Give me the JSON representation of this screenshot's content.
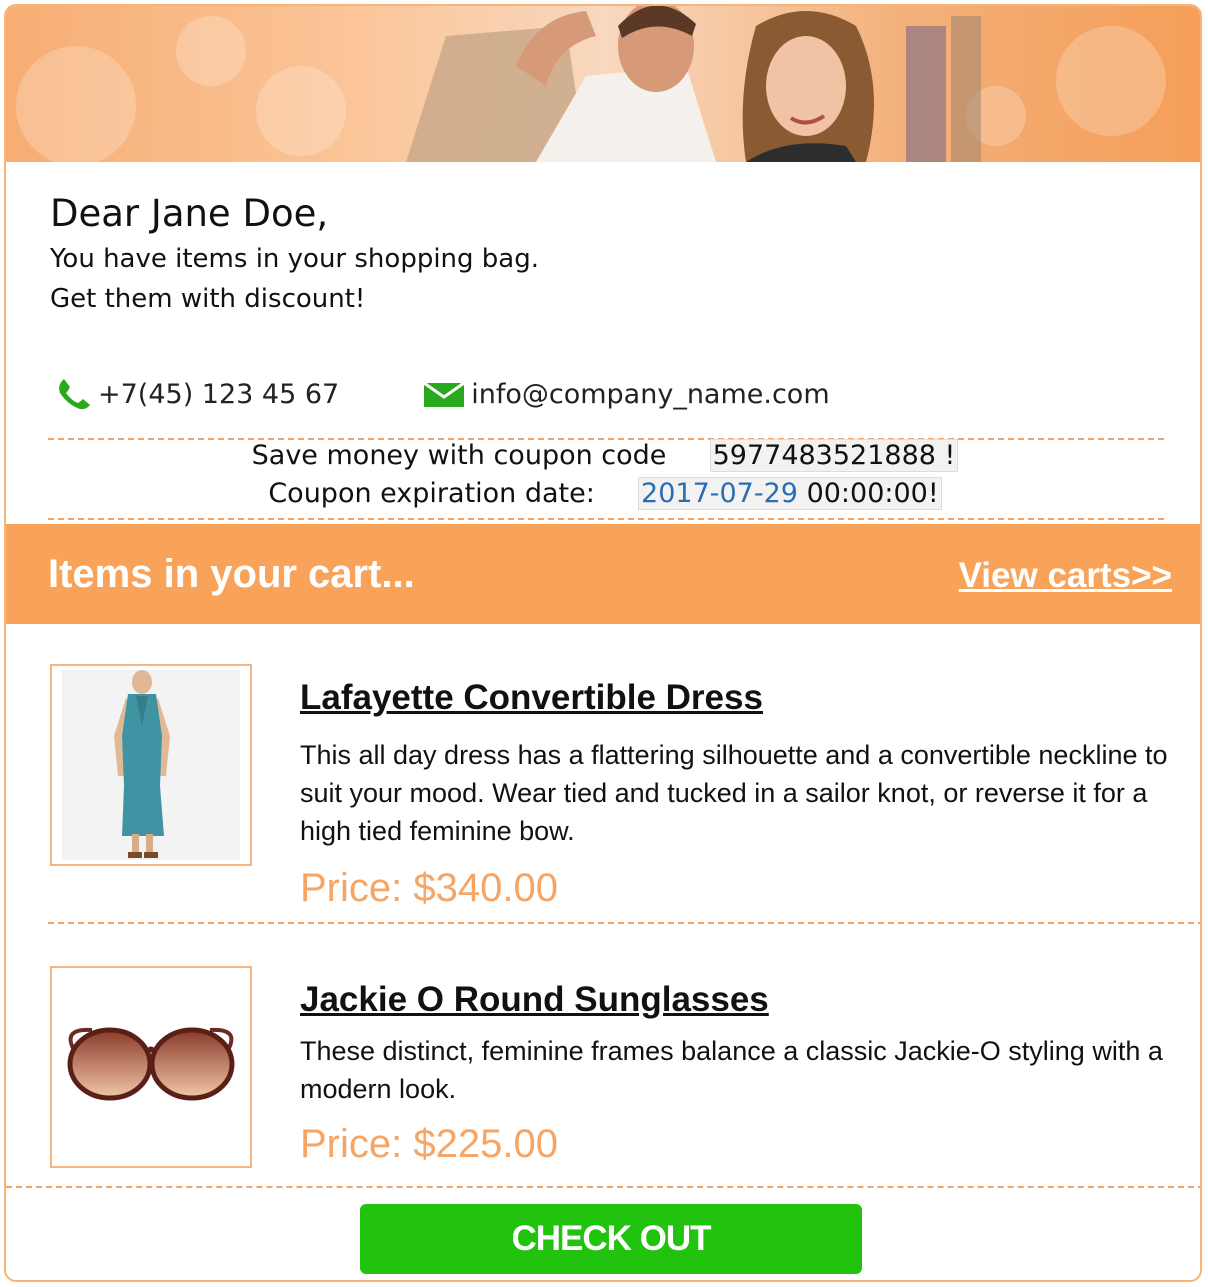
{
  "greeting": "Dear Jane Doe,",
  "intro": {
    "line1": "You have items in your shopping bag.",
    "line2": "Get them with discount!"
  },
  "contacts": {
    "phone": "+7(45) 123 45 67",
    "email": "info@company_name.com"
  },
  "coupon": {
    "code_label": "Save money with coupon code",
    "code": "5977483521888 !",
    "expiry_label": "Coupon expiration date:",
    "expiry_date": "2017-07-29",
    "expiry_time": "00:00:00!"
  },
  "cart": {
    "title": "Items in your cart...",
    "view_link": "View carts>>"
  },
  "products": [
    {
      "name": "Lafayette Convertible Dress",
      "description": "This all day dress has a flattering silhouette and a convertible neckline to suit your mood. Wear tied and tucked in a sailor knot, or reverse it for a high tied feminine bow.",
      "price": "Price: $340.00"
    },
    {
      "name": "Jackie O Round Sunglasses",
      "description": "These distinct, feminine frames balance a classic Jackie-O styling with a modern look.",
      "price": "Price: $225.00"
    }
  ],
  "checkout_label": "CHECK OUT",
  "colors": {
    "accent_orange": "#f9a35a",
    "price_orange": "#f5a666",
    "checkout_green": "#22c30f",
    "icon_green": "#2aa81e",
    "link_blue": "#2a6db0"
  },
  "icons": {
    "phone": "phone-icon",
    "email": "envelope-icon"
  }
}
